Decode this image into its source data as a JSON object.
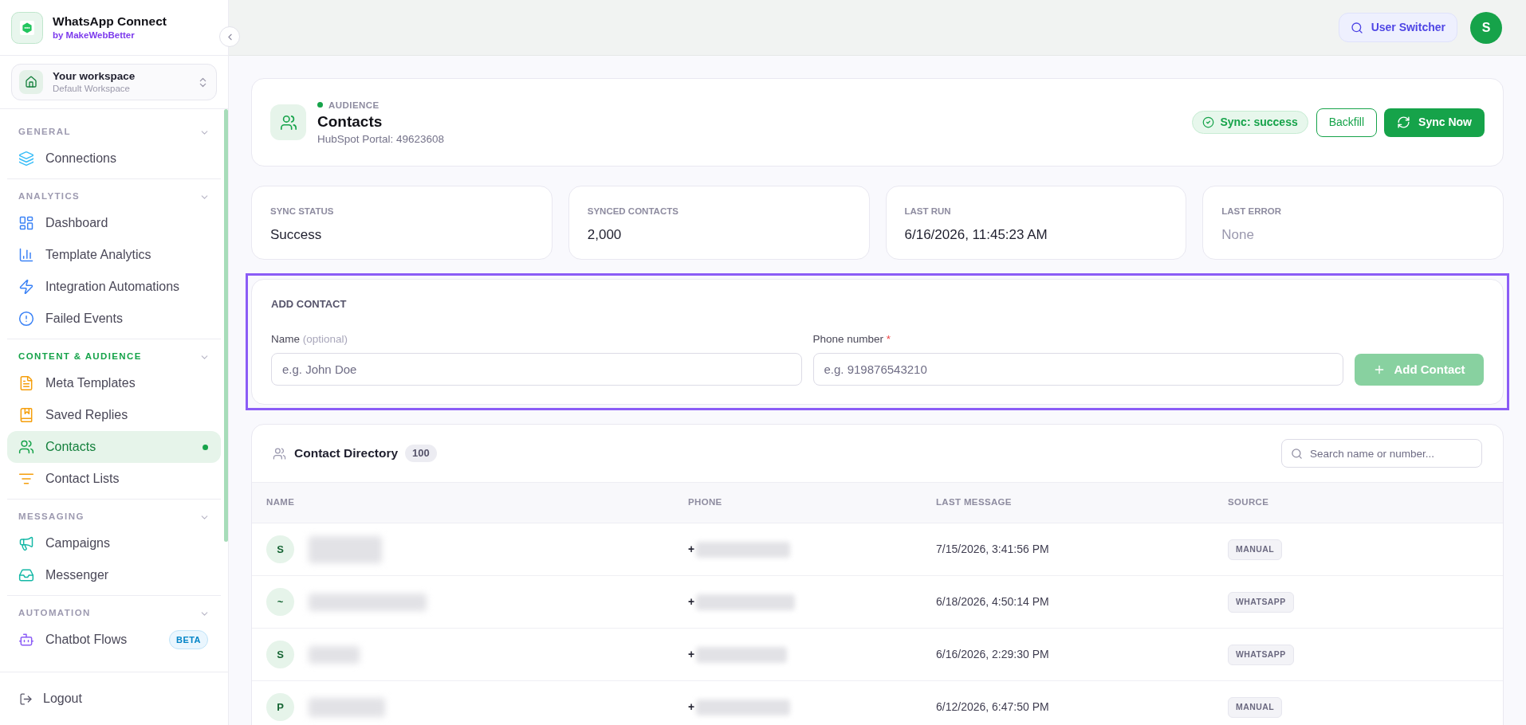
{
  "sidebar": {
    "brand": {
      "title": "WhatsApp Connect",
      "byline": "by MakeWebBetter"
    },
    "workspace": {
      "label": "Your workspace",
      "name": "Default Workspace"
    },
    "sections": [
      {
        "title": "GENERAL",
        "expanded": true,
        "items": [
          {
            "label": "Connections",
            "selected": false
          }
        ]
      },
      {
        "title": "ANALYTICS",
        "expanded": true,
        "items": [
          {
            "label": "Dashboard",
            "selected": false
          },
          {
            "label": "Template Analytics",
            "selected": false
          },
          {
            "label": "Integration Automations",
            "selected": false
          },
          {
            "label": "Failed Events",
            "selected": false
          }
        ]
      },
      {
        "title": "CONTENT & AUDIENCE",
        "expanded": true,
        "items": [
          {
            "label": "Meta Templates",
            "selected": false
          },
          {
            "label": "Saved Replies",
            "selected": false
          },
          {
            "label": "Contacts",
            "selected": true
          },
          {
            "label": "Contact Lists",
            "selected": false
          }
        ]
      },
      {
        "title": "MESSAGING",
        "expanded": true,
        "items": [
          {
            "label": "Campaigns",
            "selected": false
          },
          {
            "label": "Messenger",
            "selected": false
          }
        ]
      },
      {
        "title": "AUTOMATION",
        "expanded": true,
        "items": [
          {
            "label": "Chatbot Flows",
            "selected": false,
            "badge": "BETA"
          }
        ]
      }
    ],
    "footer": {
      "label": "Logout"
    }
  },
  "topbar": {
    "user_switcher": "User Switcher",
    "avatar": "S"
  },
  "header": {
    "eyebrow": "AUDIENCE",
    "title": "Contacts",
    "subtitle": "HubSpot Portal: 49623608",
    "sync_status": "Sync: success",
    "buttons": [
      {
        "label": "Backfill",
        "kind": "outline"
      },
      {
        "label": "Sync Now",
        "kind": "primary"
      }
    ]
  },
  "stats": [
    {
      "label": "SYNC STATUS",
      "value": "Success",
      "muted": false
    },
    {
      "label": "SYNCED CONTACTS",
      "value": "2,000",
      "muted": false
    },
    {
      "label": "LAST RUN",
      "value": "6/16/2026, 11:45:23 AM",
      "muted": false
    },
    {
      "label": "LAST ERROR",
      "value": "None",
      "muted": true
    }
  ],
  "add_contact": {
    "title": "ADD CONTACT",
    "highlighted": true,
    "fields": [
      {
        "label": "Name",
        "hint": "(optional)",
        "placeholder": "e.g. John Doe"
      },
      {
        "label": "Phone number",
        "required_mark": "*",
        "placeholder": "e.g. 919876543210"
      }
    ],
    "button": {
      "label": "Add Contact",
      "disabled": true
    }
  },
  "directory": {
    "title": "Contact Directory",
    "count": "100",
    "search": {
      "placeholder": "Search name or number..."
    },
    "table": {
      "columns": [
        "NAME",
        "PHONE",
        "LAST MESSAGE",
        "SOURCE"
      ],
      "rows": [
        {
          "avatar": "S",
          "phone": "+",
          "last_message": "7/15/2026, 3:41:56 PM",
          "source": "MANUAL"
        },
        {
          "avatar": "~",
          "phone": "+",
          "last_message": "6/18/2026, 4:50:14 PM",
          "source": "WHATSAPP"
        },
        {
          "avatar": "S",
          "phone": "+",
          "last_message": "6/16/2026, 2:29:30 PM",
          "source": "WHATSAPP"
        },
        {
          "avatar": "P",
          "phone": "+",
          "last_message": "6/12/2026, 6:47:50 PM",
          "source": "MANUAL"
        }
      ]
    }
  }
}
